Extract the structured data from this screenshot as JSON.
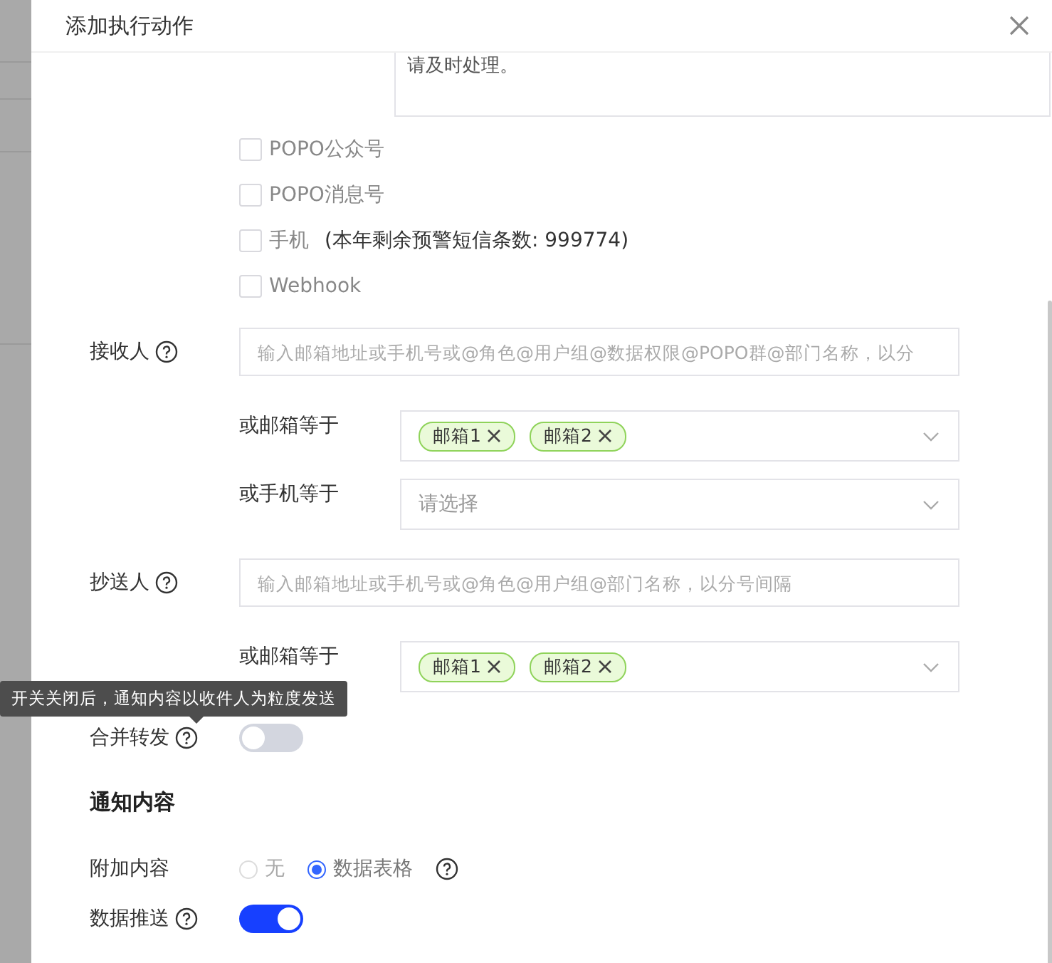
{
  "dialog": {
    "title": "添加执行动作"
  },
  "message_text": "请及时处理。",
  "channels": [
    {
      "label": "POPO公众号",
      "checked": false
    },
    {
      "label": "POPO消息号",
      "checked": false
    },
    {
      "label": "手机",
      "note": "(本年剩余预警短信条数: 999774)",
      "checked": false
    },
    {
      "label": "Webhook",
      "checked": false
    }
  ],
  "recipients": {
    "label": "接收人",
    "placeholder": "输入邮箱地址或手机号或@角色@用户组@数据权限@POPO群@部门名称，以分",
    "conditions": [
      {
        "label": "或邮箱等于",
        "tags": [
          "邮箱1",
          "邮箱2"
        ]
      },
      {
        "label": "或手机等于",
        "placeholder": "请选择"
      }
    ]
  },
  "cc": {
    "label": "抄送人",
    "placeholder": "输入邮箱地址或手机号或@角色@用户组@部门名称，以分号间隔",
    "conditions": [
      {
        "label": "或邮箱等于",
        "tags": [
          "邮箱1",
          "邮箱2"
        ]
      }
    ]
  },
  "tooltip": "开关关闭后，通知内容以收件人为粒度发送",
  "merge_forward": {
    "label": "合并转发",
    "on": false
  },
  "section_title": "通知内容",
  "attachment": {
    "label": "附加内容",
    "options": [
      {
        "label": "无",
        "selected": false,
        "disabled": true
      },
      {
        "label": "数据表格",
        "selected": true,
        "disabled": false,
        "help": true
      }
    ]
  },
  "data_push": {
    "label": "数据推送",
    "on": true
  }
}
